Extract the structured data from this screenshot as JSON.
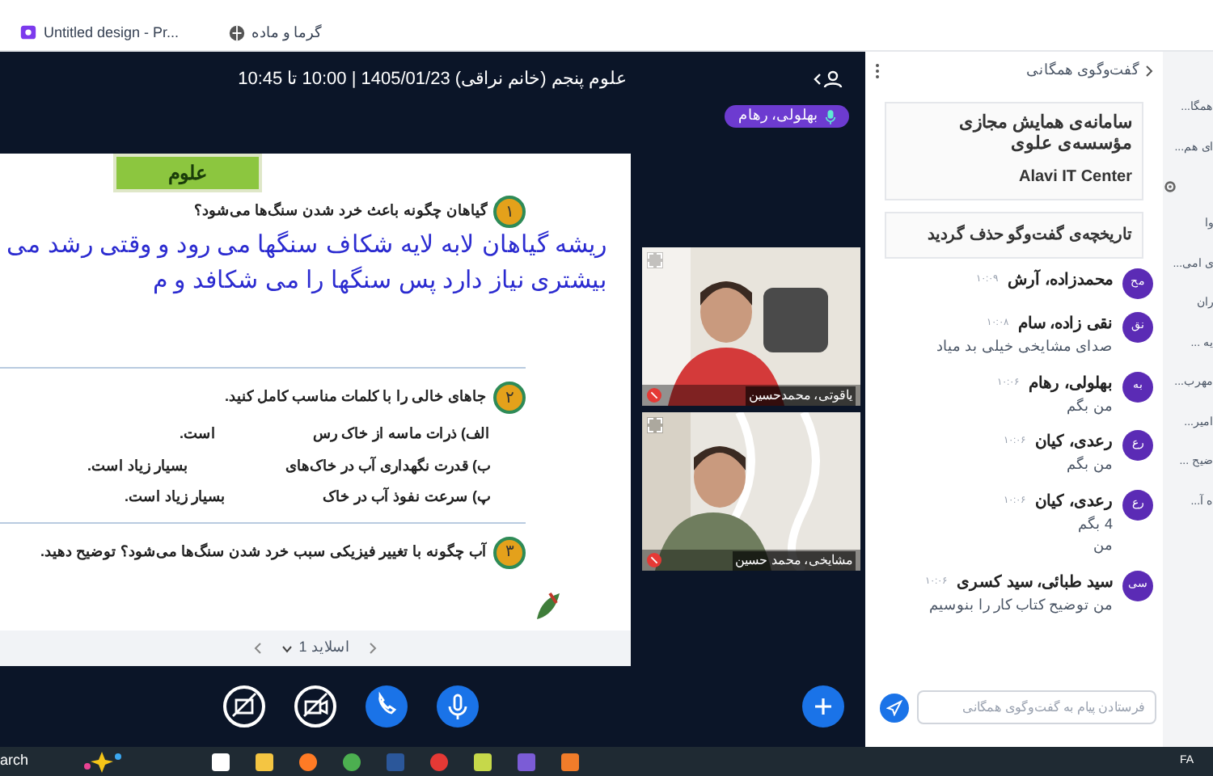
{
  "browser": {
    "bookmarks": [
      {
        "label": "گرما و ماده"
      },
      {
        "label": "Untitled design - Pr..."
      }
    ]
  },
  "meeting": {
    "title": "علوم پنجم (خانم نراقی) 1405/01/23 | 10:00 تا 10:45",
    "speaker": "بهلولی، رهام"
  },
  "slide": {
    "header": "علوم",
    "questions": [
      {
        "number": "۱",
        "text": "گیاهان چگونه باعث خرد شدن سنگ‌ها می‌شود؟",
        "answer": [
          "ریشه گیاهان لابه لایه شکاف سنگها می رود و وقتی رشد می",
          "بیشتری نیاز دارد پس سنگها را می شکافد و م"
        ]
      },
      {
        "number": "۲",
        "text": "جاهای خالی را با کلمات مناسب کامل کنید.",
        "items": [
          {
            "start": "الف) ذرات ماسه از خاک رس",
            "end": "است."
          },
          {
            "start": "ب) قدرت نگهداری آب در خاک‌های",
            "end": "بسیار زیاد است."
          },
          {
            "start": "پ) سرعت نفوذ آب در خاک",
            "end": "بسیار زیاد است."
          }
        ]
      },
      {
        "number": "۳",
        "text": "آب چگونه با تغییر فیزیکی سبب خرد شدن سنگ‌ها می‌شود؟ توضیح دهید."
      }
    ],
    "pager": "اسلاید 1"
  },
  "videos": [
    {
      "name": "یاقوتی، محمدحسین"
    },
    {
      "name": "مشایخی، محمد حسین"
    }
  ],
  "controls": [
    {
      "kind": "screen"
    },
    {
      "kind": "camera"
    },
    {
      "kind": "phone"
    },
    {
      "kind": "mic"
    }
  ],
  "chat": {
    "title": "گفت‌وگوی همگانی",
    "welcome": "سامانه‌ی همایش مجازی مؤسسه‌ی علوی",
    "welcome_en": "Alavi IT Center",
    "notice": "تاریخچه‌ی گفت‌وگو حذف گردید",
    "messages": [
      {
        "initials": "مح",
        "name": "محمدزاده، آرش",
        "time": "۱۰:۰۹"
      },
      {
        "initials": "نق",
        "name": "نقی زاده، سام",
        "time": "۱۰:۰۸",
        "lines": [
          "صدای مشایخی خیلی بد میاد"
        ]
      },
      {
        "initials": "به",
        "name": "بهلولی، رهام",
        "time": "۱۰:۰۶",
        "lines": [
          "من بگم"
        ]
      },
      {
        "initials": "رع",
        "name": "رعدی، کیان",
        "time": "۱۰:۰۶",
        "lines": [
          "من بگم"
        ]
      },
      {
        "initials": "رع",
        "name": "رعدی، کیان",
        "time": "۱۰:۰۶",
        "lines": [
          "4 بگم",
          "من"
        ]
      },
      {
        "initials": "سی",
        "name": "سید طبائی، سید کسری",
        "time": "۱۰:۰۶",
        "lines": [
          "من توضیح کتاب کار را بنوسیم"
        ]
      }
    ],
    "placeholder": "فرستادن پیام به گفت‌وگوی همگانی"
  },
  "strip": [
    "همگا...",
    "ای هم...",
    "وا",
    "ی امی...",
    "ران",
    "یه ...",
    "مهرب...",
    "امیر...",
    "ضیح ...",
    "ه آ..."
  ],
  "taskbar": {
    "search": "arch",
    "lang": "FA"
  }
}
